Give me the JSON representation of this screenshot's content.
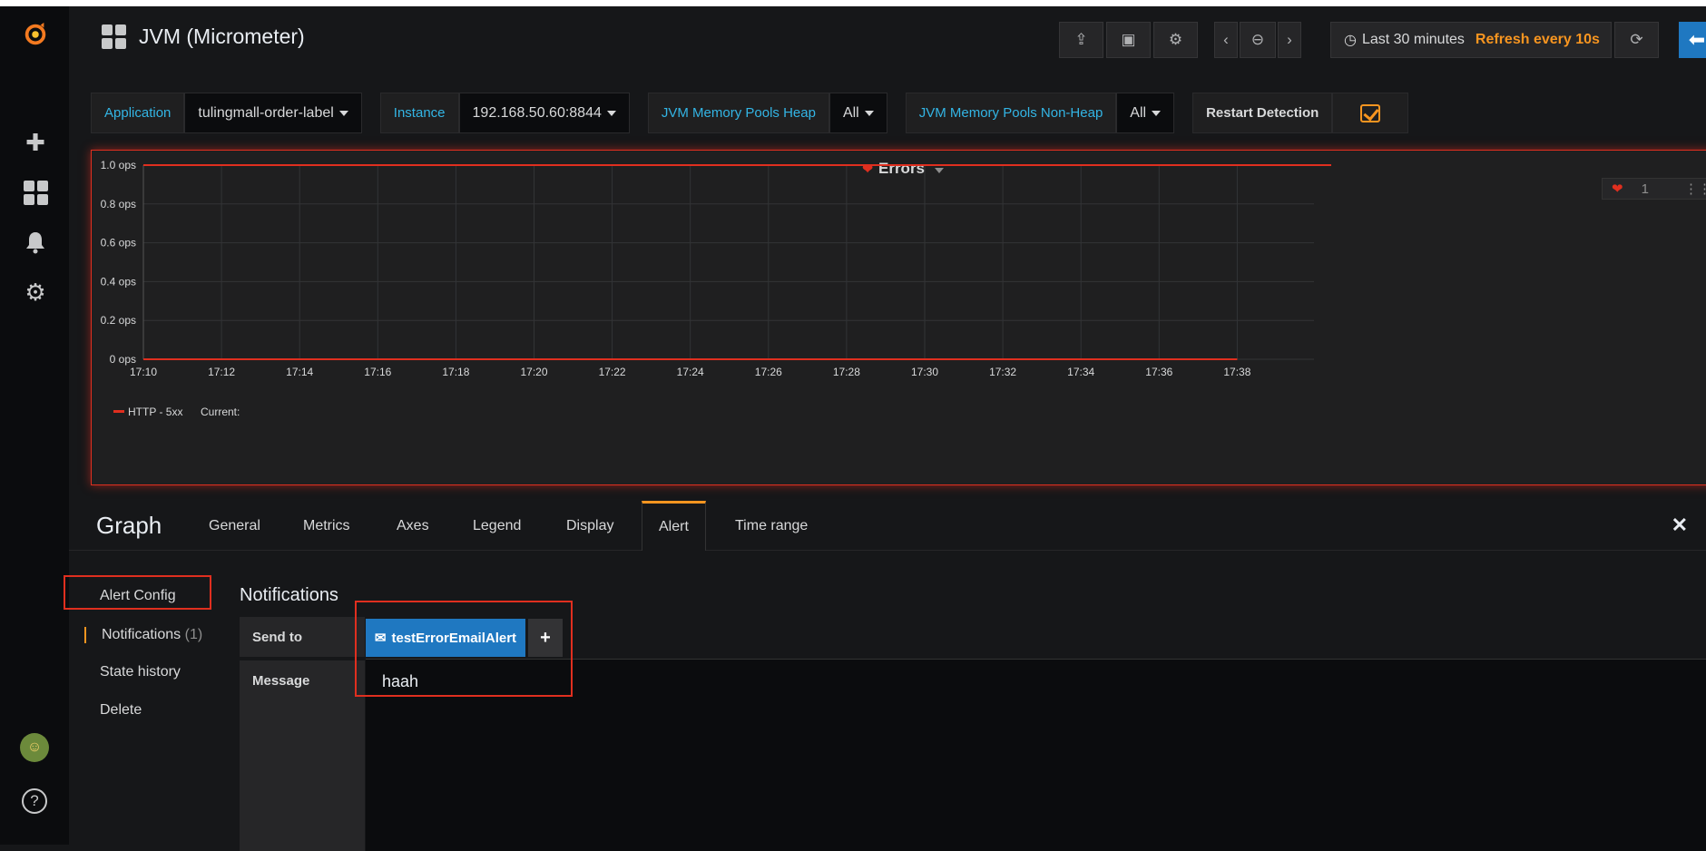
{
  "dashboard": {
    "title": "JVM (Micrometer)"
  },
  "timepicker": {
    "range": "Last 30 minutes",
    "refresh": "Refresh every 10s"
  },
  "variables": [
    {
      "label": "Application",
      "value": "tulingmall-order-label"
    },
    {
      "label": "Instance",
      "value": "192.168.50.60:8844"
    },
    {
      "label": "JVM Memory Pools Heap",
      "value": "All"
    },
    {
      "label": "JVM Memory Pools Non-Heap",
      "value": "All"
    },
    {
      "label": "Restart Detection",
      "value": ""
    }
  ],
  "panel": {
    "title": "Errors",
    "alert_count": "1"
  },
  "chart_data": {
    "type": "line",
    "title": "Errors",
    "xlabel": "",
    "ylabel": "",
    "y_unit": "ops",
    "ylim": [
      0,
      1.0
    ],
    "y_ticks": [
      "0 ops",
      "0.2 ops",
      "0.4 ops",
      "0.6 ops",
      "0.8 ops",
      "1.0 ops"
    ],
    "x_ticks": [
      "17:10",
      "17:12",
      "17:14",
      "17:16",
      "17:18",
      "17:20",
      "17:22",
      "17:24",
      "17:26",
      "17:28",
      "17:30",
      "17:32",
      "17:34",
      "17:36",
      "17:38"
    ],
    "threshold": 1.0,
    "series": [
      {
        "name": "HTTP - 5xx",
        "x": [
          "17:10",
          "17:38"
        ],
        "values": [
          0,
          0
        ],
        "color": "#e02f1f"
      }
    ],
    "legend": {
      "entry": "HTTP - 5xx",
      "suffix": "Current:",
      "placement": "bottom-left"
    },
    "grid": true
  },
  "editor": {
    "title": "Graph",
    "tabs": [
      "General",
      "Metrics",
      "Axes",
      "Legend",
      "Display",
      "Alert",
      "Time range"
    ],
    "active_tab": "Alert",
    "nav": {
      "alert_config": "Alert Config",
      "notifications": "Notifications",
      "notifications_count": "(1)",
      "state_history": "State history",
      "delete": "Delete"
    },
    "section_title": "Notifications",
    "send_to_label": "Send to",
    "notification_chip": "testErrorEmailAlert",
    "message_label": "Message",
    "message_value": "haah"
  },
  "colors": {
    "accent": "#f79520",
    "alert_red": "#e02f1f",
    "link_blue": "#33b5e5",
    "primary_blue": "#1f78c1"
  }
}
